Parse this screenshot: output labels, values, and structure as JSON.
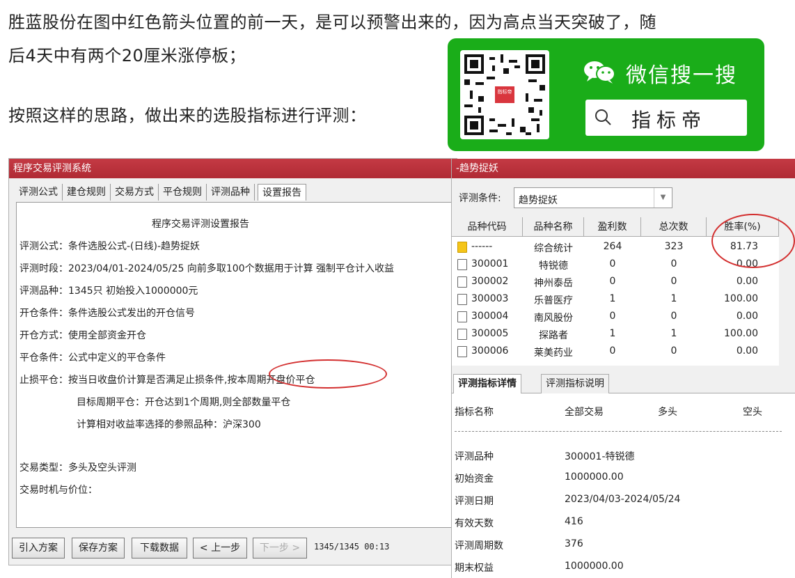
{
  "article": {
    "line1": "胜蓝股份在图中红色箭头位置的前一天，是可以预警出来的，因为高点当天突破了，随",
    "line2": "后4天中有两个20厘米涨停板；",
    "line3": "按照这样的思路，做出来的选股指标进行评测："
  },
  "wechat": {
    "title": "微信搜一搜",
    "search_text": "指标帝",
    "qr_logo": "指标帝",
    "brand_color": "#1aad19"
  },
  "left_window": {
    "title": "程序交易评测系统",
    "tabs": [
      "评测公式",
      "建仓规则",
      "交易方式",
      "平仓规则",
      "评测品种",
      "设置报告"
    ],
    "report_title": "程序交易评测设置报告",
    "lines": [
      "评测公式：条件选股公式-(日线)-趋势捉妖",
      "评测时段：2023/04/01-2024/05/25 向前多取100个数据用于计算 强制平仓计入收益",
      "评测品种：1345只 初始投入1000000元",
      "开仓条件：条件选股公式发出的开仓信号",
      "开仓方式：使用全部资金开仓",
      "平仓条件：公式中定义的平仓条件",
      "止损平仓：按当日收盘价计算是否满足止损条件,按本周期开盘价平仓",
      "目标周期平仓：开仓达到1个周期,则全部数量平仓",
      "计算相对收益率选择的参照品种：沪深300",
      "交易类型：多头及空头评测",
      "交易时机与价位："
    ],
    "buttons": [
      "引入方案",
      "保存方案",
      "下载数据",
      "< 上一步",
      "下一步 >"
    ],
    "status": "1345/1345 00:13"
  },
  "right_window": {
    "title": "-趋势捉妖",
    "cond_label": "评测条件:",
    "cond_value": "趋势捉妖",
    "columns": [
      "品种代码",
      "品种名称",
      "盈利数",
      "总次数",
      "胜率(%)"
    ],
    "rows": [
      {
        "code": "------",
        "name": "综合统计",
        "profit": "264",
        "total": "323",
        "rate": "81.73",
        "folder": true
      },
      {
        "code": "300001",
        "name": "特锐德",
        "profit": "0",
        "total": "0",
        "rate": "0.00",
        "folder": false
      },
      {
        "code": "300002",
        "name": "神州泰岳",
        "profit": "0",
        "total": "0",
        "rate": "0.00",
        "folder": false
      },
      {
        "code": "300003",
        "name": "乐普医疗",
        "profit": "1",
        "total": "1",
        "rate": "100.00",
        "folder": false
      },
      {
        "code": "300004",
        "name": "南风股份",
        "profit": "0",
        "total": "0",
        "rate": "0.00",
        "folder": false
      },
      {
        "code": "300005",
        "name": "探路者",
        "profit": "1",
        "total": "1",
        "rate": "100.00",
        "folder": false
      },
      {
        "code": "300006",
        "name": "莱美药业",
        "profit": "0",
        "total": "0",
        "rate": "0.00",
        "folder": false
      }
    ],
    "detail_tabs": [
      "评测指标详情",
      "评测指标说明"
    ],
    "detail_head": [
      "指标名称",
      "全部交易",
      "多头",
      "空头"
    ],
    "details": [
      {
        "label": "评测品种",
        "value": "300001-特锐德"
      },
      {
        "label": "初始资金",
        "value": "1000000.00"
      },
      {
        "label": "评测日期",
        "value": "2023/04/03-2024/05/24"
      },
      {
        "label": "有效天数",
        "value": "416"
      },
      {
        "label": "评测周期数",
        "value": "376"
      },
      {
        "label": "期末权益",
        "value": "1000000.00"
      }
    ]
  },
  "highlight_color": "#d32f2f",
  "titlebar_color": "#b02a34"
}
